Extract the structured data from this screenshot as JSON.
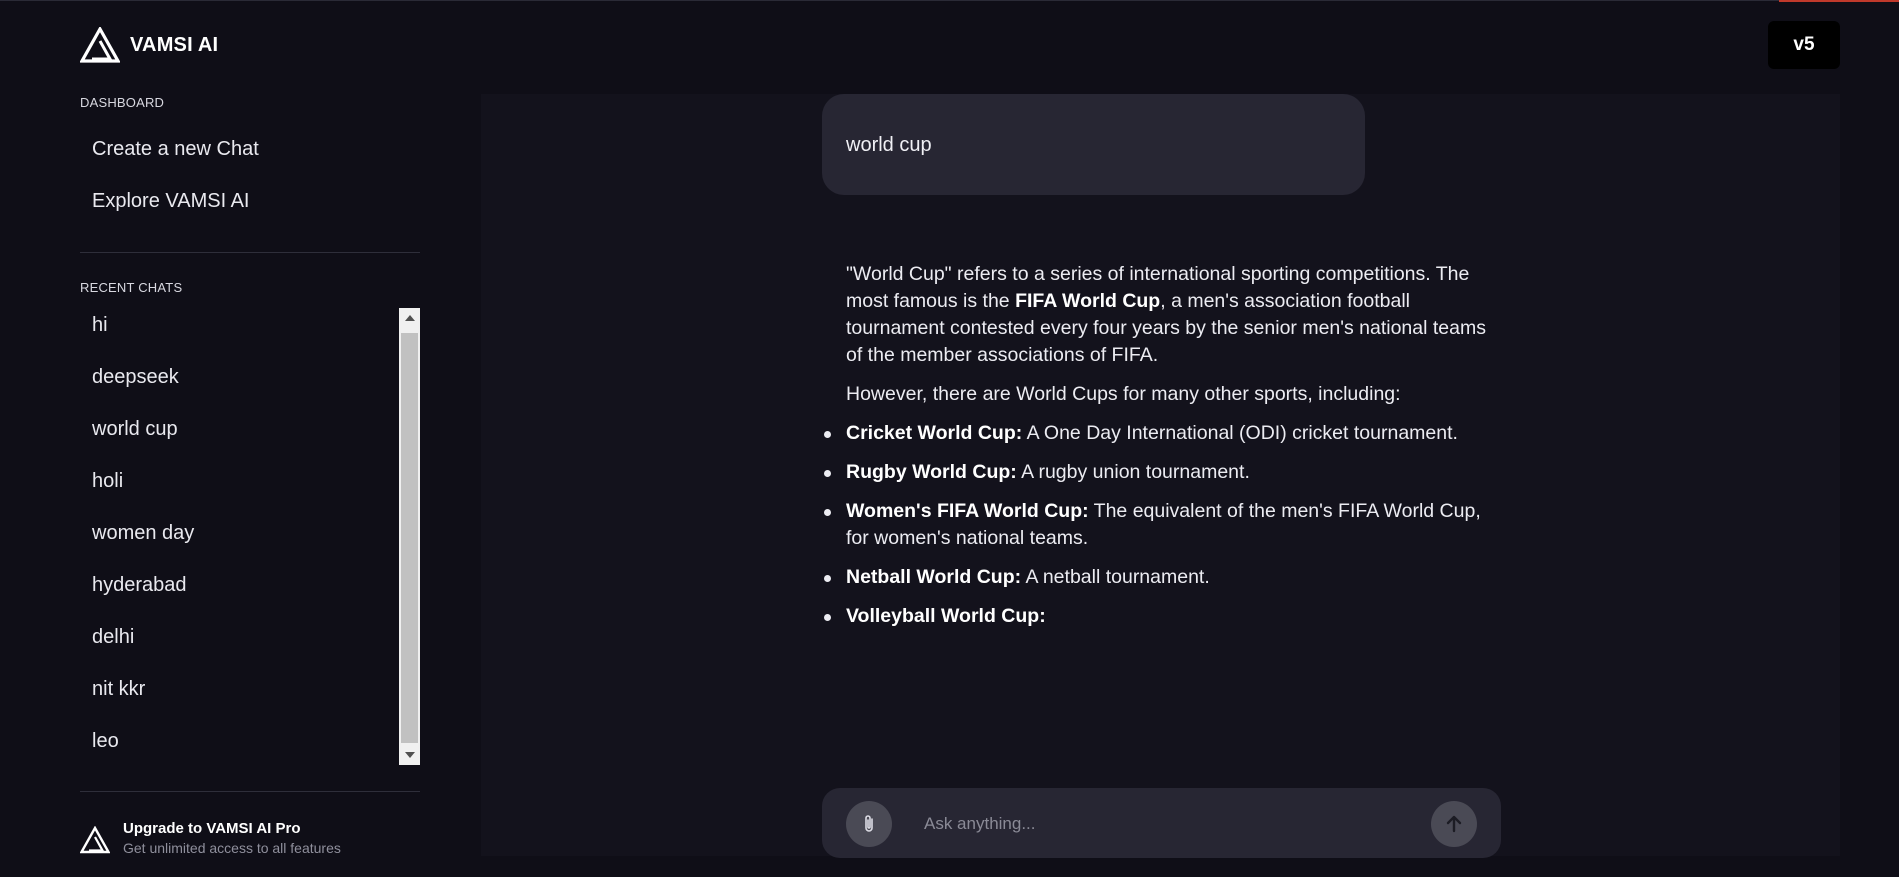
{
  "brand": {
    "name": "VAMSI AI",
    "logo_icon": "vamsi-logo-icon"
  },
  "version": {
    "label": "v5"
  },
  "sidebar": {
    "dashboard_label": "DASHBOARD",
    "nav": [
      {
        "label": "Create a new Chat"
      },
      {
        "label": "Explore VAMSI AI"
      }
    ],
    "recent_label": "RECENT CHATS",
    "recent": [
      {
        "label": "hi"
      },
      {
        "label": "deepseek"
      },
      {
        "label": "world cup"
      },
      {
        "label": "holi"
      },
      {
        "label": "women day"
      },
      {
        "label": "hyderabad"
      },
      {
        "label": "delhi"
      },
      {
        "label": "nit kkr"
      },
      {
        "label": "leo"
      }
    ],
    "upgrade": {
      "title": "Upgrade to VAMSI AI Pro",
      "subtitle": "Get unlimited access to all features"
    }
  },
  "chat": {
    "user_message": "world cup",
    "answer": {
      "p1_a": "\"World Cup\" refers to a series of international sporting competitions. The most famous is the ",
      "p1_bold": "FIFA World Cup",
      "p1_b": ", a men's association football tournament contested every four years by the senior men's national teams of the member associations of FIFA.",
      "p2": "However, there are World Cups for many other sports, including:",
      "items": [
        {
          "bold": "Cricket World Cup:",
          "text": " A One Day International (ODI) cricket tournament."
        },
        {
          "bold": "Rugby World Cup:",
          "text": " A rugby union tournament."
        },
        {
          "bold": "Women's FIFA World Cup:",
          "text": " The equivalent of the men's FIFA World Cup, for women's national teams."
        },
        {
          "bold": "Netball World Cup:",
          "text": " A netball tournament."
        },
        {
          "bold": "Volleyball World Cup:",
          "text": ""
        }
      ]
    }
  },
  "composer": {
    "placeholder": "Ask anything...",
    "attach_icon": "paperclip-icon",
    "send_icon": "arrow-up-icon"
  },
  "colors": {
    "background": "#0f0e17",
    "panel": "#13121c",
    "bubble": "#272633",
    "button": "#4a4a55"
  }
}
